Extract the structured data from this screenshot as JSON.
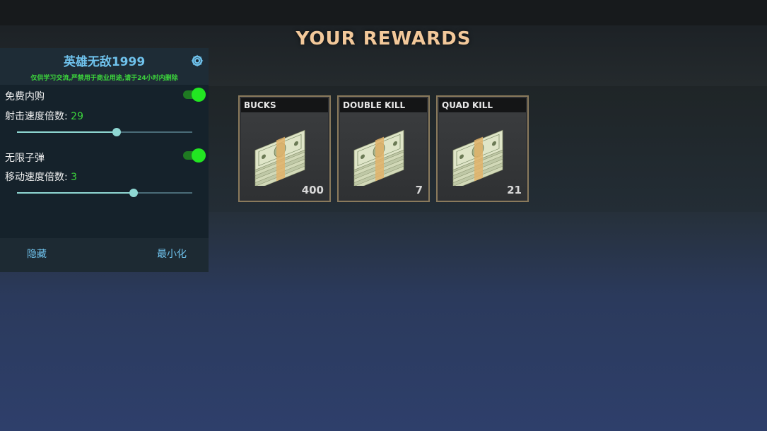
{
  "header": {
    "title": "YOUR REWARDS"
  },
  "rewards": [
    {
      "label": "BUCKS",
      "count": "400",
      "icon": "cash-stack-icon"
    },
    {
      "label": "DOUBLE KILL",
      "count": "7",
      "icon": "cash-stack-icon"
    },
    {
      "label": "QUAD KILL",
      "count": "21",
      "icon": "cash-stack-icon"
    }
  ],
  "mod_menu": {
    "title": "英雄无敌1999",
    "warning": "仅供学习交流,严禁用于商业用途,请于24小时内删除",
    "settings_icon": "gear-icon",
    "options": [
      {
        "label": "免费内购",
        "enabled": true
      },
      {
        "label": "射击速度倍数: ",
        "value": "29",
        "fraction": 0.57
      },
      {
        "label": "无限子弹",
        "enabled": true
      },
      {
        "label": "移动速度倍数: ",
        "value": "3",
        "fraction": 0.667
      }
    ],
    "hide_label": "隐藏",
    "minimize_label": "最小化"
  },
  "colors": {
    "title": "#f2c89a",
    "menu_accent": "#6fc2ec",
    "toggle_on": "#22e622",
    "value_green": "#3cd43c",
    "slider": "#8fd8d3",
    "card_border": "#8a7a5c"
  }
}
